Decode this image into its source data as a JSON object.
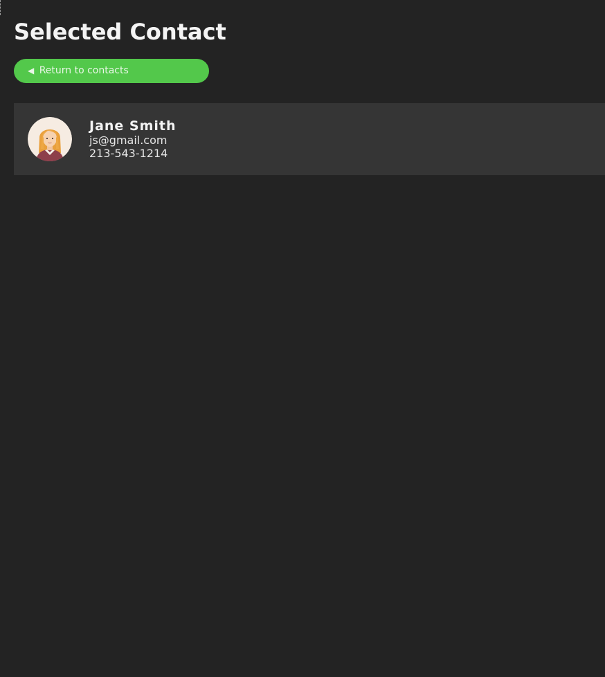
{
  "page": {
    "title": "Selected Contact"
  },
  "actions": {
    "back_arrow": "◀",
    "back_label": "Return to contacts"
  },
  "contact": {
    "name": "Jane Smith",
    "email": "js@gmail.com",
    "phone": "213-543-1214",
    "avatar_icon": "woman-avatar"
  },
  "colors": {
    "background": "#232323",
    "card": "#353535",
    "accent": "#53c84b"
  }
}
